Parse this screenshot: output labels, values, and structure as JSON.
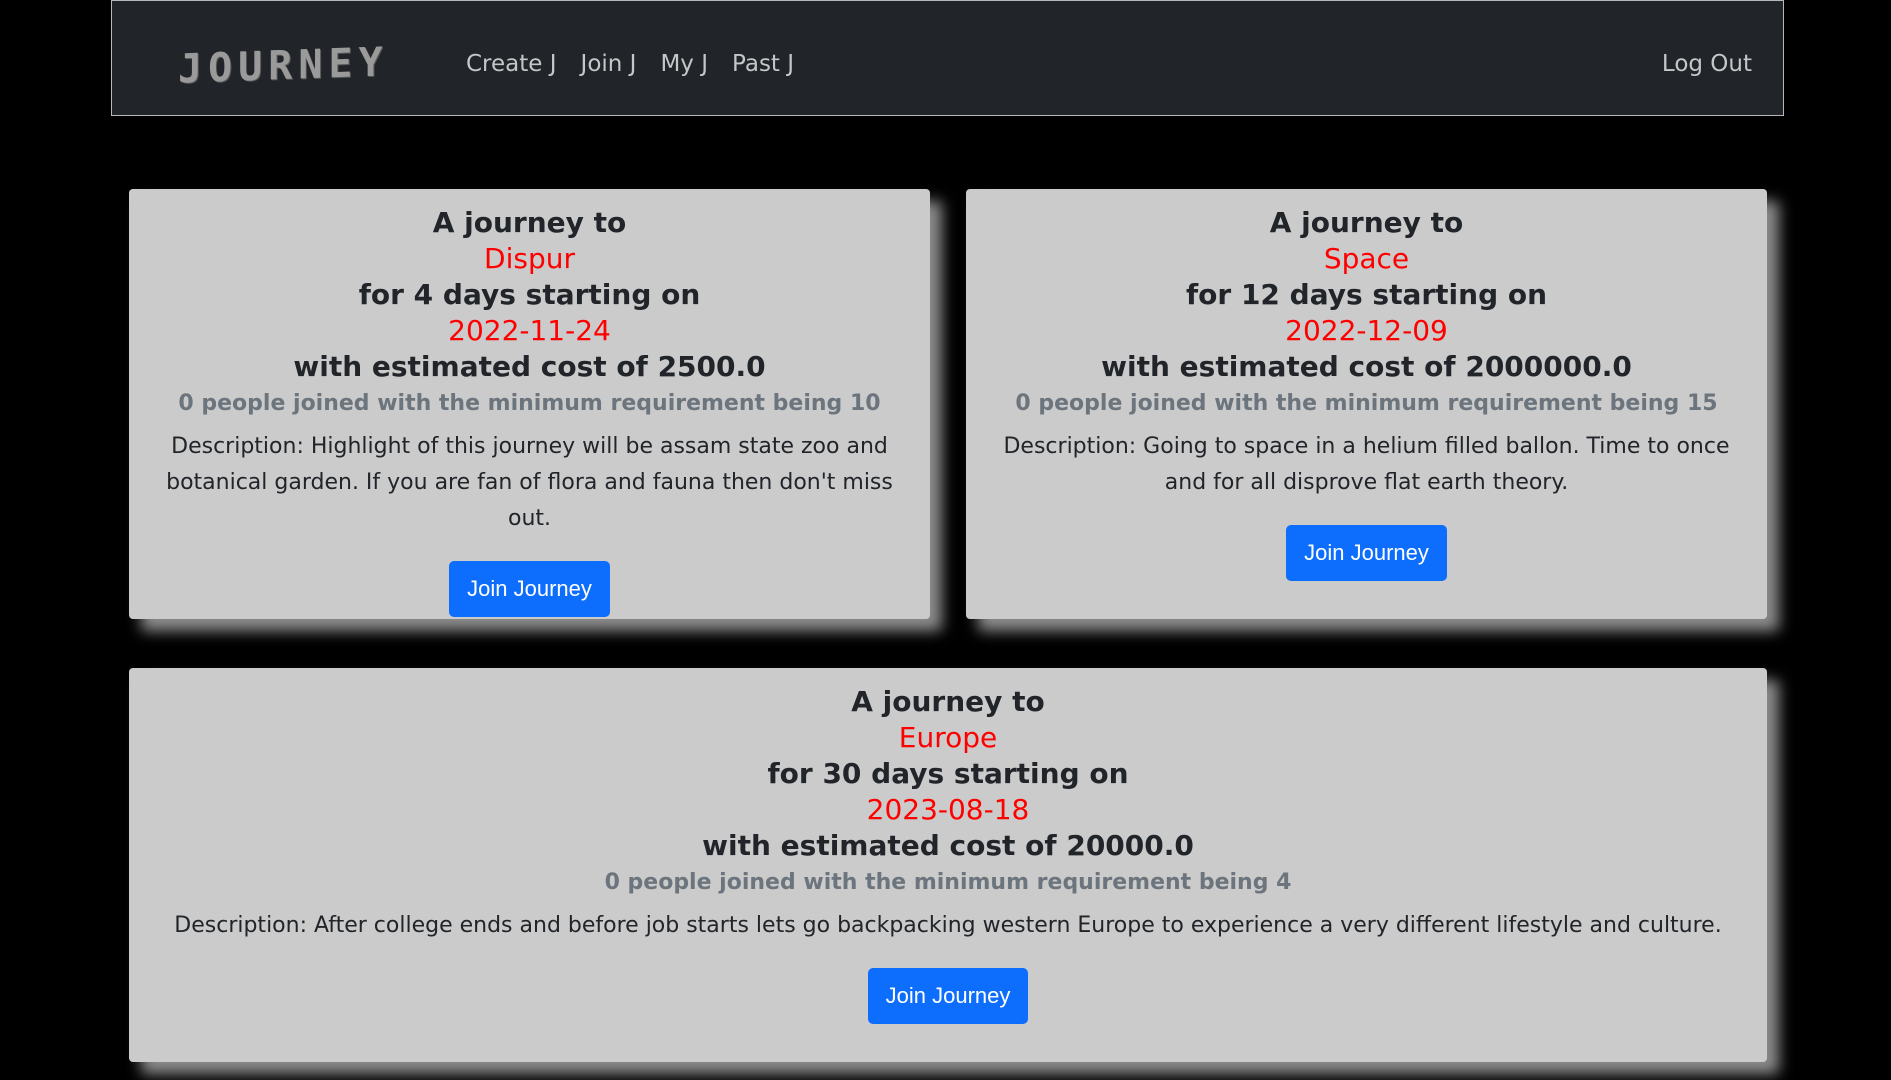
{
  "nav": {
    "brand": "JOURNEY",
    "links": [
      "Create J",
      "Join J",
      "My J",
      "Past J"
    ],
    "logout": "Log Out"
  },
  "cards": [
    {
      "prefix": "A journey to",
      "destination": "Dispur",
      "duration": "for 4 days starting on",
      "date": "2022-11-24",
      "cost": "with estimated cost of 2500.0",
      "joined": "0 people joined with the minimum requirement being 10",
      "description": "Description: Highlight of this journey will be assam state zoo and botanical garden. If you are fan of flora and fauna then don't miss out.",
      "button": "Join Journey"
    },
    {
      "prefix": "A journey to",
      "destination": "Space",
      "duration": "for 12 days starting on",
      "date": "2022-12-09",
      "cost": "with estimated cost of 2000000.0",
      "joined": "0 people joined with the minimum requirement being 15",
      "description": "Description: Going to space in a helium filled ballon. Time to once and for all disprove flat earth theory.",
      "button": "Join Journey"
    },
    {
      "prefix": "A journey to",
      "destination": "Europe",
      "duration": "for 30 days starting on",
      "date": "2023-08-18",
      "cost": "with estimated cost of 20000.0",
      "joined": "0 people joined with the minimum requirement being 4",
      "description": "Description: After college ends and before job starts lets go backpacking western Europe to experience a very different lifestyle and culture.",
      "button": "Join Journey"
    }
  ],
  "colors": {
    "navbar": "#212529",
    "card": "#cbcbcb",
    "accent_red": "#ff0000",
    "button": "#0d6efd"
  }
}
